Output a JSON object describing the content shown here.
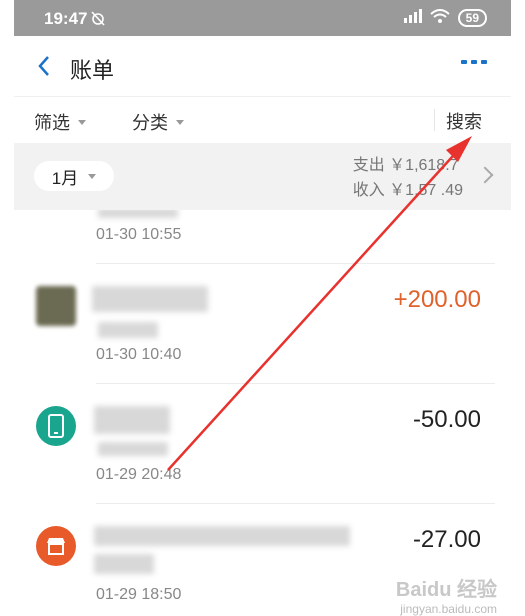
{
  "status_bar": {
    "time": "19:47",
    "battery": "59"
  },
  "header": {
    "title": "账单"
  },
  "filters": {
    "filter_label": "筛选",
    "category_label": "分类",
    "search_label": "搜索"
  },
  "summary": {
    "month": "1月",
    "expense": "支出 ￥1,618.7",
    "income": "收入 ￥1,57 .49"
  },
  "transactions": [
    {
      "time": "01-30 10:55",
      "amount": ""
    },
    {
      "time": "01-30 10:40",
      "amount": "+200.00"
    },
    {
      "time": "01-29 20:48",
      "amount": "-50.00"
    },
    {
      "time": "01-29 18:50",
      "amount": "-27.00"
    }
  ],
  "watermark": {
    "brand": "Baidu 经验",
    "url": "jingyan.baidu.com"
  },
  "colors": {
    "accent": "#1a73c8",
    "positive": "#e0612c",
    "phone_icon": "#1aa58e",
    "shop_icon": "#e85a2a",
    "arrow": "#e8322e"
  }
}
